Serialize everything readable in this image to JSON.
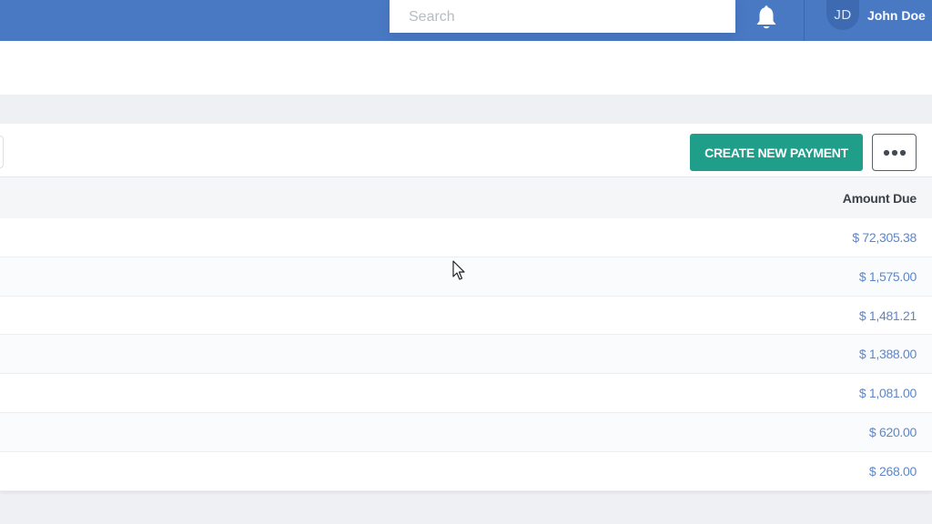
{
  "header": {
    "search_placeholder": "Search",
    "user": {
      "initials": "JD",
      "name": "John Doe"
    }
  },
  "toolbar": {
    "create_label": "CREATE NEW PAYMENT",
    "more_icon": "ellipsis-icon"
  },
  "table": {
    "columns": [
      "Amount Due"
    ],
    "rows": [
      {
        "amount_due": "$ 72,305.38"
      },
      {
        "amount_due": "$ 1,575.00"
      },
      {
        "amount_due": "$ 1,481.21"
      },
      {
        "amount_due": "$ 1,388.00"
      },
      {
        "amount_due": "$ 1,081.00"
      },
      {
        "amount_due": "$ 620.00"
      },
      {
        "amount_due": "$ 268.00"
      }
    ]
  },
  "colors": {
    "topbar": "#4a79c4",
    "accent_button": "#1f9e8a",
    "amount_link": "#5d86c9"
  }
}
